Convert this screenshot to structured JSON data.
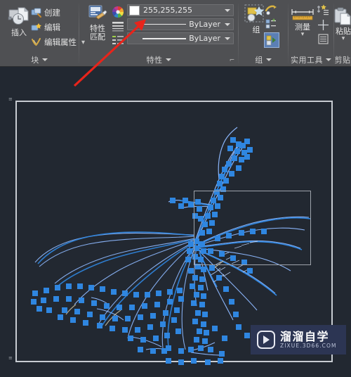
{
  "ribbon": {
    "panels": [
      {
        "id": "block",
        "label": "块",
        "big_button": {
          "label": "插入",
          "icon": "insert-block-icon"
        },
        "items": [
          {
            "label": "创建",
            "icon": "create-block-icon"
          },
          {
            "label": "编辑",
            "icon": "edit-block-icon"
          },
          {
            "label": "编辑属性",
            "icon": "edit-attributes-icon"
          }
        ]
      },
      {
        "id": "properties",
        "label": "特性",
        "big_button": {
          "label_line1": "特性",
          "label_line2": "匹配",
          "icon": "match-properties-icon"
        },
        "color_wheel_icon": "color-wheel-icon",
        "linetype_icon": "linetype-list-icon",
        "lineweight_icon": "lineweight-list-icon",
        "dropdowns": [
          {
            "name": "object-color",
            "value": "255,255,255",
            "swatch": "#ffffff"
          },
          {
            "name": "object-linetype",
            "value": "ByLayer"
          },
          {
            "name": "object-lineweight",
            "value": "ByLayer"
          }
        ],
        "dialog_launcher": "⌐"
      },
      {
        "id": "group",
        "label": "组",
        "big_button": {
          "label": "组",
          "icon": "create-group-icon"
        },
        "items": [
          {
            "icon": "edit-group-icon"
          },
          {
            "icon": "add-to-group-icon"
          },
          {
            "icon": "group-selection-toggle-icon",
            "active": true
          }
        ]
      },
      {
        "id": "utilities",
        "label": "实用工具",
        "big_button": {
          "label": "测量",
          "icon": "measure-icon"
        },
        "items": [
          {
            "icon": "quick-select-icon"
          },
          {
            "icon": "point-marker-icon"
          },
          {
            "icon": "list-icon"
          }
        ]
      },
      {
        "id": "clipboard",
        "label": "剪贴",
        "big_button": {
          "label": "粘贴",
          "icon": "paste-icon"
        }
      }
    ]
  },
  "canvas": {
    "viewport_name": "model-viewport",
    "selection_window_name": "selection-window",
    "background": "#222831",
    "entity_color": "#2f86e0",
    "highlight_color": "#8ab4f8"
  },
  "annotation": {
    "arrow_name": "red-callout-arrow",
    "color": "#e8241b",
    "points_to": "object-color-dropdown"
  },
  "watermark": {
    "title": "溜溜自学",
    "subtitle": "ZIXUE.3D66.COM",
    "logo_icon": "play-button-icon",
    "bg": "#2c3553"
  }
}
